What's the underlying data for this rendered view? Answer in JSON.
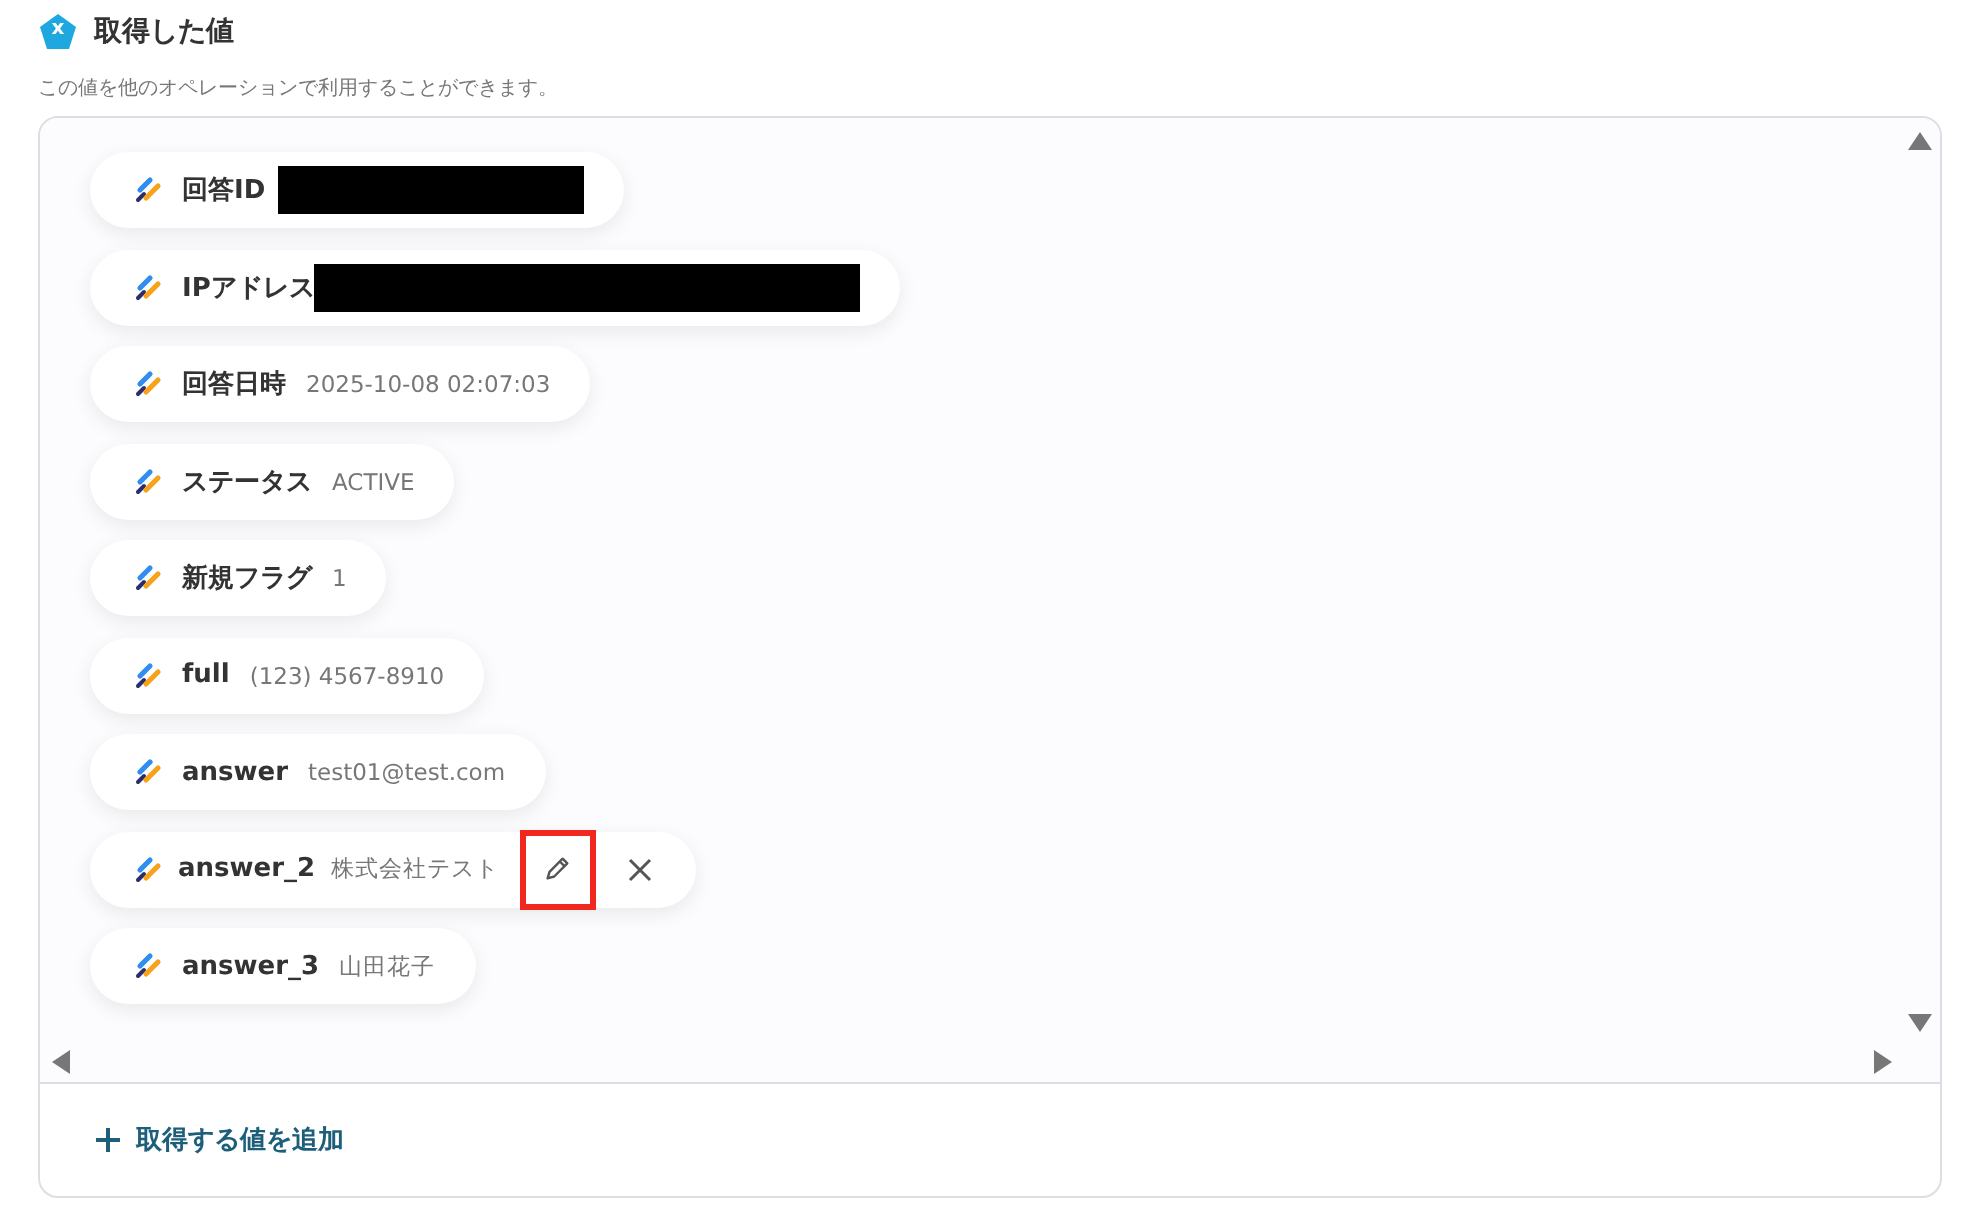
{
  "header": {
    "icon_letter": "x",
    "title": "取得した値",
    "description": "この値を他のオペレーションで利用することができます。"
  },
  "values": [
    {
      "label": "回答ID",
      "redacted": true,
      "hovered": false
    },
    {
      "label": "IPアドレス",
      "redacted": true,
      "wide": true,
      "hovered": false
    },
    {
      "label": "回答日時",
      "value": "2025-10-08 02:07:03",
      "redacted": false,
      "hovered": false
    },
    {
      "label": "ステータス",
      "value": "ACTIVE",
      "redacted": false,
      "hovered": false
    },
    {
      "label": "新規フラグ",
      "value": "1",
      "redacted": false,
      "hovered": false
    },
    {
      "label": "full",
      "value": "(123) 4567-8910",
      "redacted": false,
      "hovered": false
    },
    {
      "label": "answer",
      "value": "test01@test.com",
      "redacted": false,
      "hovered": false
    },
    {
      "label": "answer_2",
      "value": "株式会社テスト",
      "redacted": false,
      "hovered": true,
      "edit_highlighted": true
    },
    {
      "label": "answer_3",
      "value": "山田花子",
      "redacted": false,
      "hovered": false
    }
  ],
  "add_button": {
    "label": "取得する値を追加"
  }
}
